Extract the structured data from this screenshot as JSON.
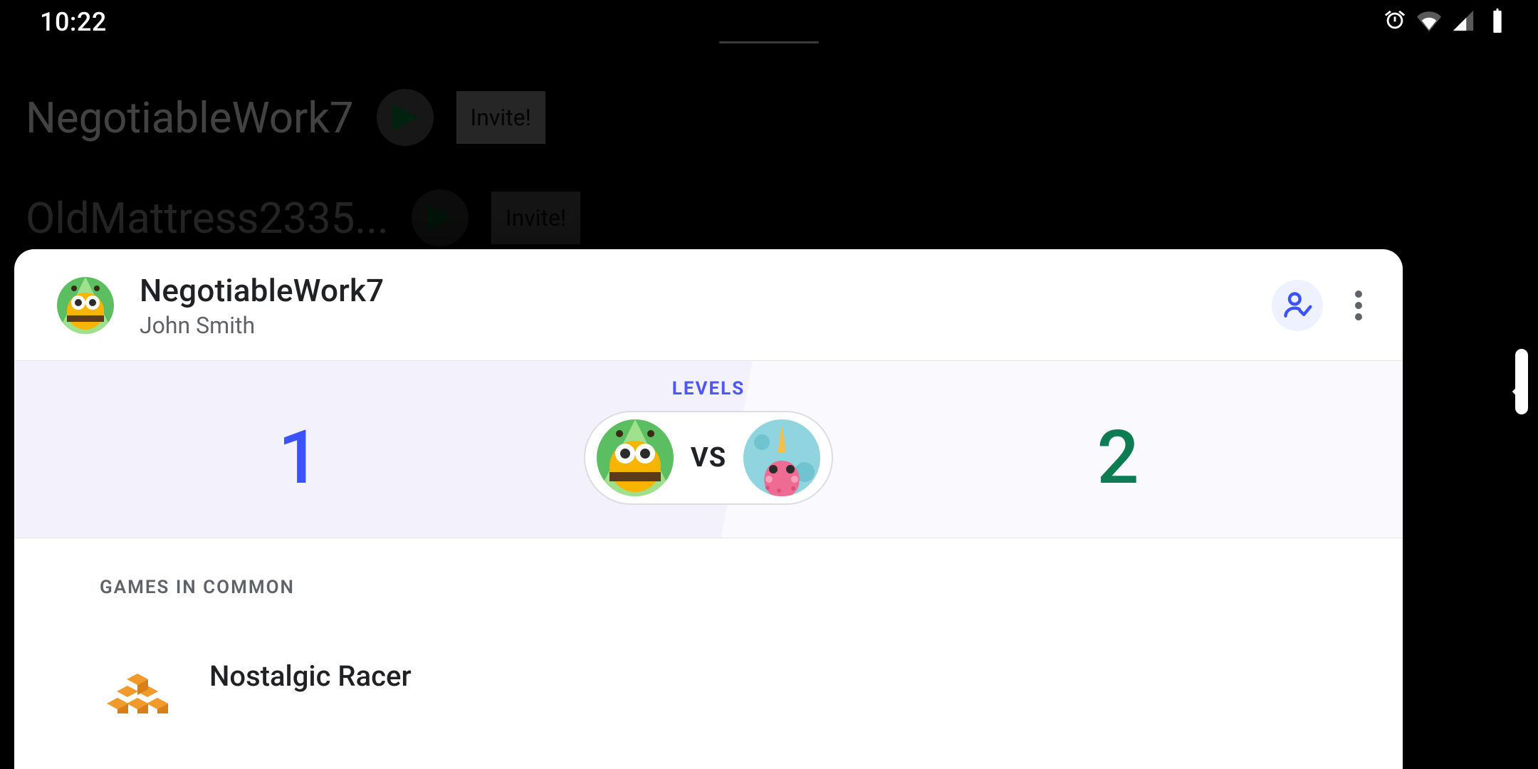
{
  "status": {
    "time": "10:22"
  },
  "background_rows": [
    {
      "name": "NegotiableWork7",
      "invite_label": "Invite!"
    },
    {
      "name": "OldMattress2335...",
      "invite_label": "Invite!"
    }
  ],
  "sheet": {
    "username": "NegotiableWork7",
    "realname": "John Smith"
  },
  "levels": {
    "title": "LEVELS",
    "left_value": "1",
    "vs_label": "VS",
    "right_value": "2"
  },
  "games_in_common": {
    "heading": "GAMES IN COMMON",
    "items": [
      {
        "title": "Nostalgic Racer"
      }
    ]
  }
}
